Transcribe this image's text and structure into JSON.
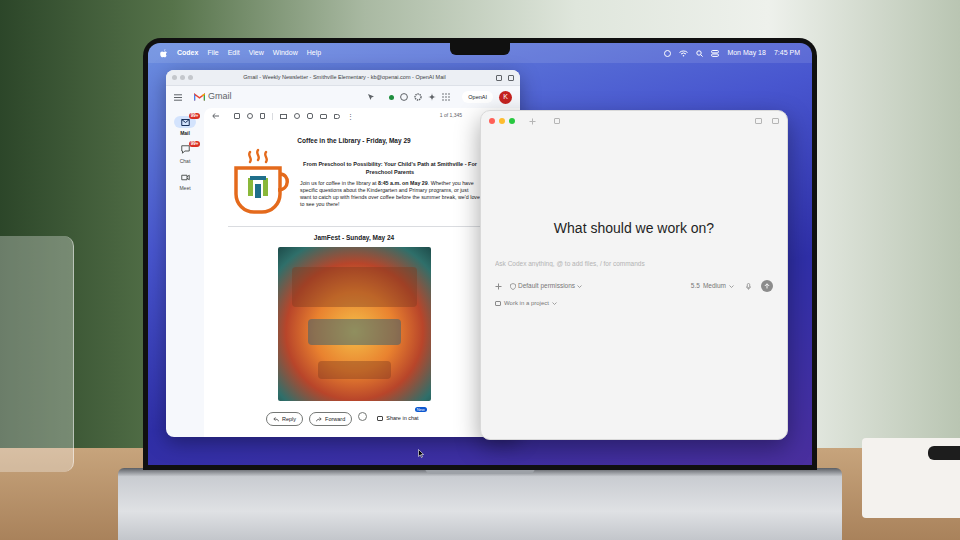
{
  "menu_bar": {
    "app": "Codex",
    "items": [
      "File",
      "Edit",
      "View",
      "Window",
      "Help"
    ],
    "date": "Mon May 18",
    "time": "7:45 PM"
  },
  "gmail": {
    "title": "Gmail - Weekly Newsletter - Smithville Elementary - kb@openai.com - OpenAI Mail",
    "logo": "Gmail",
    "workspace": "OpenAI",
    "avatar": "K",
    "nav": [
      {
        "label": "Mail",
        "badge": "99+",
        "selected": true
      },
      {
        "label": "Chat",
        "badge": "99+",
        "selected": false
      },
      {
        "label": "Meet",
        "selected": false
      }
    ],
    "pager": "1 of 1,345",
    "coffee": {
      "heading": "Coffee in the Library - Friday, May 29",
      "subheading": "From Preschool to Possibility: Your Child's Path at Smithville - For Preschool Parents",
      "body": [
        {
          "text": "Join us for coffee in the library at ",
          "bold": false
        },
        {
          "text": "8:45 a.m. on May 29",
          "bold": true
        },
        {
          "text": ". Whether you have specific questions about the Kindergarten and Primary programs, or just want to catch up with friends over coffee before the summer break, we'd love to see you there!",
          "bold": false
        }
      ]
    },
    "jamfest": {
      "heading": "JamFest - Sunday, May 24"
    },
    "actions": [
      {
        "label": "Reply"
      },
      {
        "label": "Forward"
      }
    ],
    "share": {
      "label": "Share in chat",
      "badge": "New"
    }
  },
  "codex": {
    "heading": "What should we work on?",
    "placeholder": "Ask Codex anything, @ to add files, / for commands",
    "permissions": "Default permissions",
    "model": "5.5",
    "effort": "Medium",
    "project": "Work in a project"
  }
}
